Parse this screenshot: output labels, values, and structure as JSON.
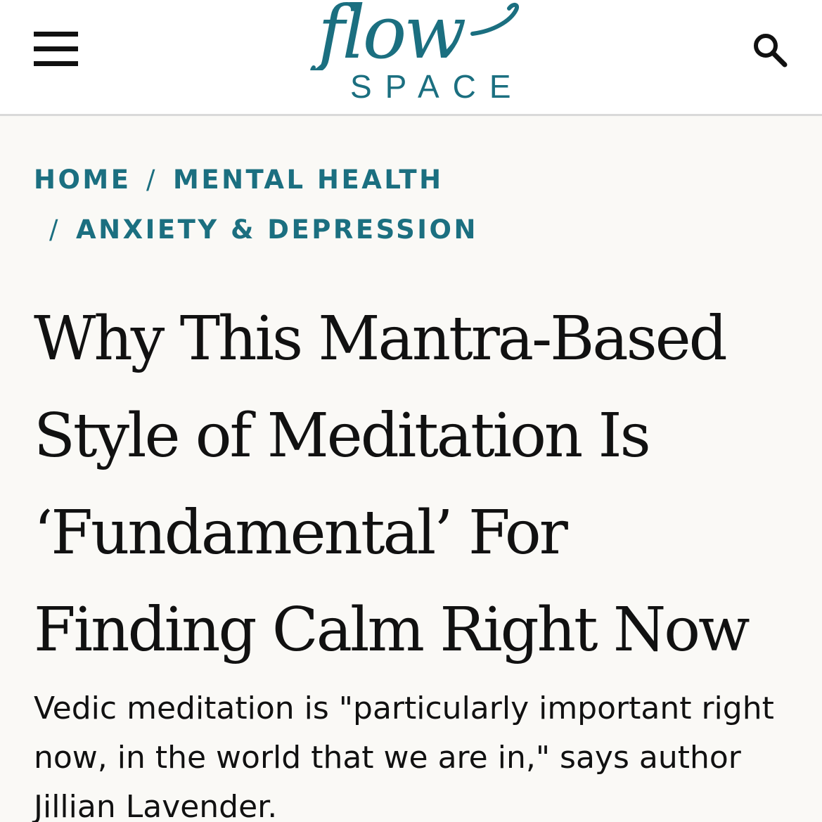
{
  "header": {
    "logo": {
      "script_text": "flow",
      "sub_text": "SPACE",
      "color": "#1b6f80"
    },
    "menu_icon": "hamburger-menu-icon",
    "search_icon": "search-icon"
  },
  "breadcrumb": {
    "items": [
      {
        "label": "HOME"
      },
      {
        "label": "MENTAL HEALTH"
      },
      {
        "label": "ANXIETY & DEPRESSION"
      }
    ],
    "separator": "/"
  },
  "article": {
    "title": "Why This Mantra-Based Style of Meditation Is ‘Fundamental’ For Finding Calm Right Now",
    "deck": "Vedic meditation is \"particularly important right now, in the world that we are in,\" says author Jillian Lavender."
  },
  "colors": {
    "accent": "#1b6f80",
    "text": "#111111",
    "background": "#faf9f6",
    "header_background": "#ffffff",
    "divider": "#d9d9d9"
  }
}
